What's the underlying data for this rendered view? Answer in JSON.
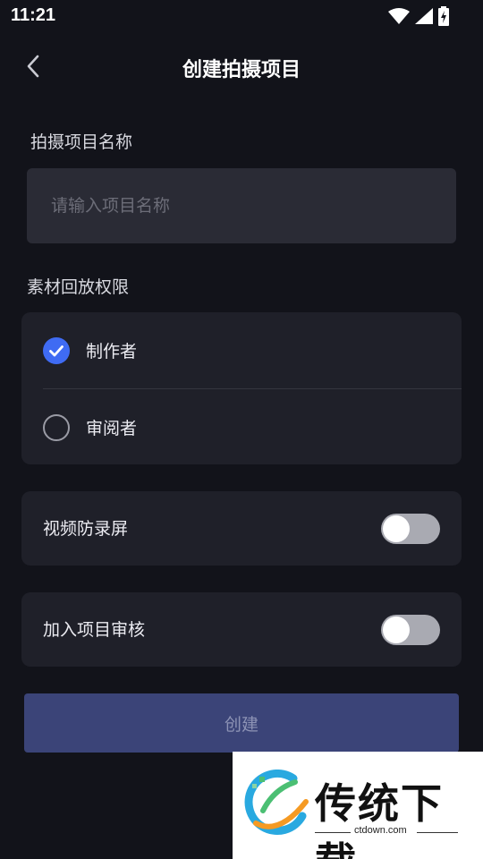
{
  "status_bar": {
    "time": "11:21"
  },
  "header": {
    "title": "创建拍摄项目"
  },
  "project_name": {
    "label": "拍摄项目名称",
    "placeholder": "请输入项目名称",
    "value": ""
  },
  "playback_permission": {
    "label": "素材回放权限",
    "options": [
      {
        "label": "制作者",
        "checked": true
      },
      {
        "label": "审阅者",
        "checked": false
      }
    ]
  },
  "toggles": {
    "anti_screen_record": {
      "label": "视频防录屏",
      "on": false
    },
    "join_project_review": {
      "label": "加入项目审核",
      "on": false
    }
  },
  "create_button": {
    "label": "创建",
    "enabled": false
  },
  "watermark": {
    "title": "传统下载",
    "url": "ctdown.com"
  },
  "colors": {
    "background": "#12131a",
    "card": "#1f2029",
    "accent": "#3f6bf3",
    "button": "#3b4478"
  }
}
